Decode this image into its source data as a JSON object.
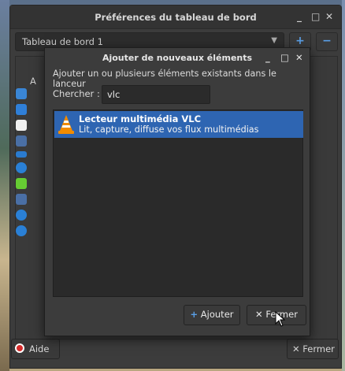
{
  "back_window": {
    "title": "Préférences du tableau de bord",
    "minimize": "_",
    "maximize": "□",
    "close": "✕",
    "panel_select": "Tableau de bord 1",
    "add_panel": "+",
    "remove_panel": "−",
    "partial_tab": "A",
    "help_label": "Aide",
    "close_label": "✕ Fermer"
  },
  "dialog": {
    "title": "Ajouter de nouveaux éléments",
    "minimize": "_",
    "maximize": "□",
    "close": "✕",
    "subtitle": "Ajouter un ou plusieurs éléments existants dans le lanceur",
    "search_label": "Chercher :",
    "search_value": "vlc",
    "results": [
      {
        "name": "Lecteur multimédia VLC",
        "description": "Lit, capture, diffuse vos flux multimédias",
        "icon": "vlc-cone-icon",
        "selected": true
      }
    ],
    "add_button": "Ajouter",
    "add_icon": "+",
    "close_button": "Fermer",
    "close_icon": "✕"
  },
  "colors": {
    "selection": "#2e65b2",
    "window_bg": "#3c3c3c",
    "accent_blue": "#5aa0e8"
  }
}
